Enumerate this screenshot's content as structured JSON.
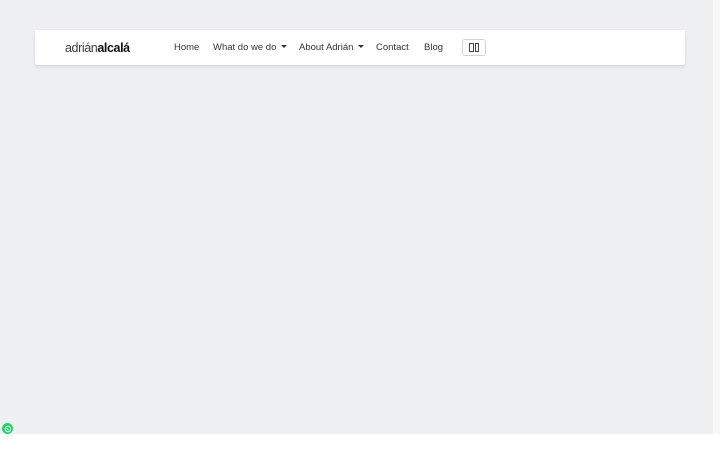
{
  "brand": {
    "first": "adrián",
    "last": "alcalá"
  },
  "nav": {
    "items": [
      {
        "label": "Home",
        "dropdown": false
      },
      {
        "label": "What do we do",
        "dropdown": true
      },
      {
        "label": "About Adrián",
        "dropdown": true
      },
      {
        "label": "Contact",
        "dropdown": false
      },
      {
        "label": "Blog",
        "dropdown": false
      }
    ]
  },
  "icons": {
    "language_toggle": "split-panel-icon",
    "chat": "whatsapp-icon"
  },
  "colors": {
    "page_background": "#eff0f2",
    "navbar_background": "#ffffff",
    "whatsapp": "#25d366"
  }
}
